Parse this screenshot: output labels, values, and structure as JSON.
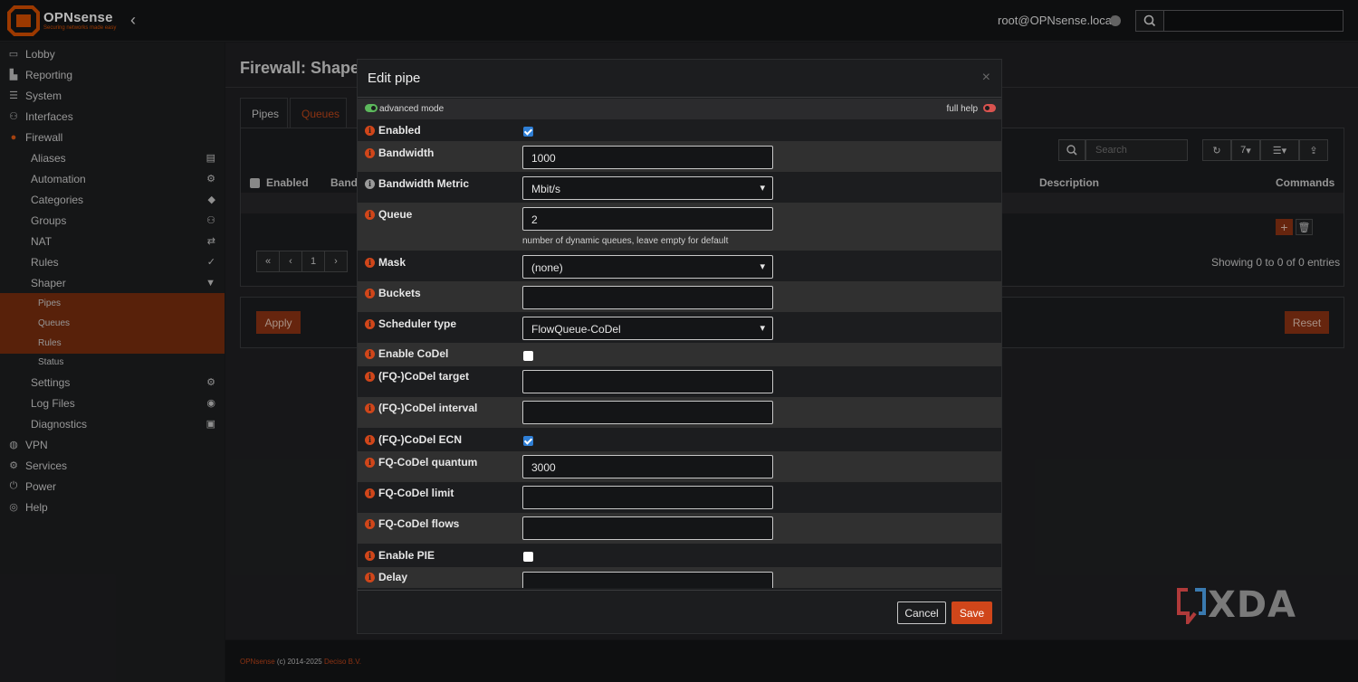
{
  "topbar": {
    "brand": "OPNsense",
    "tagline": "Securing networks made easy",
    "user": "root@OPNsense.local",
    "search_placeholder": ""
  },
  "sidebar": {
    "items": [
      {
        "label": "Lobby",
        "icon": "laptop-icon"
      },
      {
        "label": "Reporting",
        "icon": "chart-icon"
      },
      {
        "label": "System",
        "icon": "server-icon"
      },
      {
        "label": "Interfaces",
        "icon": "network-icon"
      },
      {
        "label": "Firewall",
        "icon": "fire-icon"
      },
      {
        "label": "Aliases",
        "icon": "list-icon"
      },
      {
        "label": "Automation",
        "icon": "cog-icon"
      },
      {
        "label": "Categories",
        "icon": "tags-icon"
      },
      {
        "label": "Groups",
        "icon": "sitemap-icon"
      },
      {
        "label": "NAT",
        "icon": "exchange-icon"
      },
      {
        "label": "Rules",
        "icon": "check-icon"
      },
      {
        "label": "Shaper",
        "icon": "filter-icon"
      },
      {
        "label": "Pipes"
      },
      {
        "label": "Queues"
      },
      {
        "label": "Rules"
      },
      {
        "label": "Status"
      },
      {
        "label": "Settings",
        "icon": "cogs-icon"
      },
      {
        "label": "Log Files",
        "icon": "eye-icon"
      },
      {
        "label": "Diagnostics",
        "icon": "medkit-icon"
      },
      {
        "label": "VPN",
        "icon": "globe-icon"
      },
      {
        "label": "Services",
        "icon": "cog-icon"
      },
      {
        "label": "Power",
        "icon": "plug-icon"
      },
      {
        "label": "Help",
        "icon": "lifebuoy-icon"
      }
    ]
  },
  "main": {
    "title": "Firewall: Shape",
    "tabs": [
      "Pipes",
      "Queues"
    ],
    "search_placeholder": "Search",
    "page_size": "7",
    "columns": {
      "enabled": "Enabled",
      "bandwidth": "Band",
      "description": "Description",
      "commands": "Commands"
    },
    "pagination": [
      "«",
      "‹",
      "1",
      "›"
    ],
    "showing": "Showing 0 to 0 of 0 entries",
    "apply": "Apply",
    "reset": "Reset"
  },
  "footer": {
    "brand": "OPNsense",
    "copyright": " (c) 2014-2025 ",
    "company": "Deciso B.V."
  },
  "modal": {
    "title": "Edit pipe",
    "close": "×",
    "advanced_mode": "advanced mode",
    "full_help": "full help",
    "fields": {
      "enabled": {
        "label": "Enabled",
        "checked": true
      },
      "bandwidth": {
        "label": "Bandwidth",
        "value": "1000"
      },
      "bandwidth_metric": {
        "label": "Bandwidth Metric",
        "value": "Mbit/s"
      },
      "queue": {
        "label": "Queue",
        "value": "2",
        "hint": "number of dynamic queues, leave empty for default"
      },
      "mask": {
        "label": "Mask",
        "value": "(none)"
      },
      "buckets": {
        "label": "Buckets",
        "value": ""
      },
      "scheduler": {
        "label": "Scheduler type",
        "value": "FlowQueue-CoDel"
      },
      "enable_codel": {
        "label": "Enable CoDel",
        "checked": false
      },
      "codel_target": {
        "label": "(FQ-)CoDel target",
        "value": ""
      },
      "codel_interval": {
        "label": "(FQ-)CoDel interval",
        "value": ""
      },
      "codel_ecn": {
        "label": "(FQ-)CoDel ECN",
        "checked": true
      },
      "fq_quantum": {
        "label": "FQ-CoDel quantum",
        "value": "3000"
      },
      "fq_limit": {
        "label": "FQ-CoDel limit",
        "value": ""
      },
      "fq_flows": {
        "label": "FQ-CoDel flows",
        "value": ""
      },
      "enable_pie": {
        "label": "Enable PIE",
        "checked": false
      },
      "delay": {
        "label": "Delay",
        "value": ""
      }
    },
    "cancel": "Cancel",
    "save": "Save"
  },
  "watermark": "XDA",
  "colors": {
    "accent": "#d0461a",
    "sidebar_active": "#7a2e0f",
    "checkbox": "#2f7fd6"
  }
}
